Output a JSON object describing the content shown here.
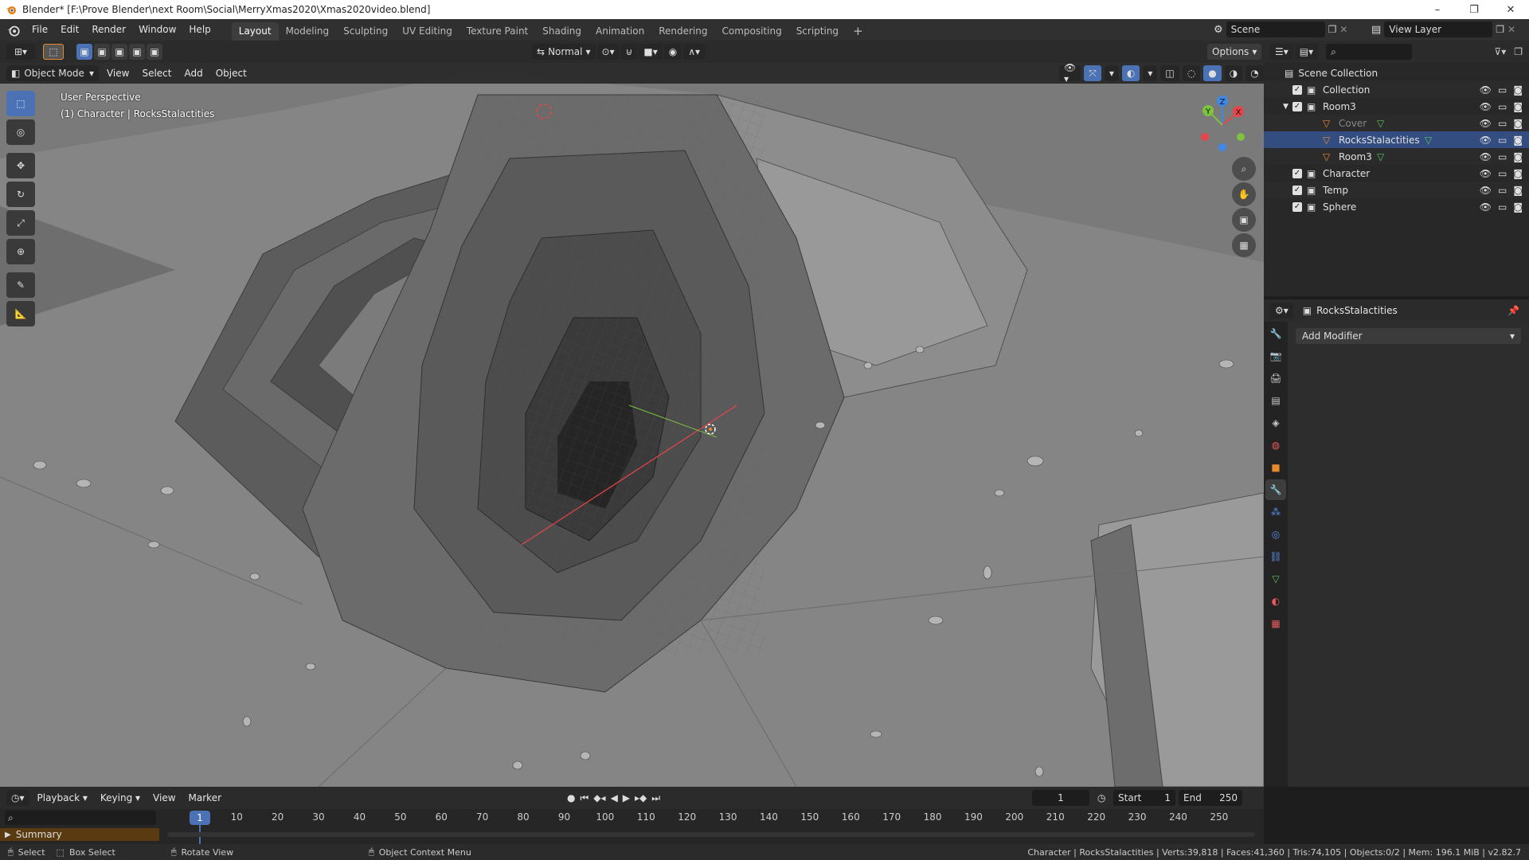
{
  "window": {
    "title": "Blender* [F:\\Prove Blender\\next Room\\Social\\MerryXmas2020\\Xmas2020video.blend]",
    "controls": [
      "–",
      "❐",
      "✕"
    ]
  },
  "menu": [
    "File",
    "Edit",
    "Render",
    "Window",
    "Help"
  ],
  "workspaces": [
    "Layout",
    "Modeling",
    "Sculpting",
    "UV Editing",
    "Texture Paint",
    "Shading",
    "Animation",
    "Rendering",
    "Compositing",
    "Scripting"
  ],
  "active_workspace": "Layout",
  "add_workspace": "+",
  "scene": {
    "label": "Scene",
    "view_layer": "View Layer"
  },
  "viewport_header": {
    "orientation": "Normal",
    "options": "Options"
  },
  "viewport_header2": {
    "mode": "Object Mode",
    "menus": [
      "View",
      "Select",
      "Add",
      "Object"
    ]
  },
  "viewport_overlay": {
    "perspective": "User Perspective",
    "context": "(1) Character | RocksStalactities"
  },
  "gizmo": {
    "x": "X",
    "y": "Y",
    "z": "Z"
  },
  "outliner": {
    "root": "Scene Collection",
    "rows": [
      {
        "label": "Collection",
        "indent": 0,
        "type": "collection"
      },
      {
        "label": "Room3",
        "indent": 0,
        "type": "collection",
        "expanded": true
      },
      {
        "label": "Cover",
        "indent": 1,
        "type": "object",
        "dim": true
      },
      {
        "label": "RocksStalactities",
        "indent": 1,
        "type": "object",
        "selected": true
      },
      {
        "label": "Room3",
        "indent": 1,
        "type": "object"
      },
      {
        "label": "Character",
        "indent": 0,
        "type": "collection"
      },
      {
        "label": "Temp",
        "indent": 0,
        "type": "collection"
      },
      {
        "label": "Sphere",
        "indent": 0,
        "type": "collection"
      }
    ]
  },
  "properties": {
    "object_name": "RocksStalactities",
    "add_modifier": "Add Modifier",
    "tabs": [
      "tool-icon",
      "render-icon",
      "output-icon",
      "view-layer-icon",
      "scene-icon",
      "world-icon",
      "object-icon",
      "modifier-icon",
      "particles-icon",
      "physics-icon",
      "constraints-icon",
      "data-icon",
      "material-icon",
      "texture-icon"
    ],
    "active_tab": "modifier-icon"
  },
  "timeline": {
    "menus": [
      "Playback",
      "Keying",
      "View",
      "Marker"
    ],
    "current_frame": "1",
    "start_label": "Start",
    "start": "1",
    "end_label": "End",
    "end": "250",
    "frame_marks": [
      "10",
      "20",
      "30",
      "40",
      "50",
      "60",
      "70",
      "80",
      "90",
      "100",
      "110",
      "120",
      "130",
      "140",
      "150",
      "160",
      "170",
      "180",
      "190",
      "200",
      "210",
      "220",
      "230",
      "240",
      "250"
    ],
    "summary": "Summary"
  },
  "statusbar": {
    "select": "Select",
    "box_select": "Box Select",
    "rotate_view": "Rotate View",
    "context_menu": "Object Context Menu",
    "stats": "Character | RocksStalactities | Verts:39,818 | Faces:41,360 | Tris:74,105 | Objects:0/2 | Mem: 196.1 MiB | v2.82.7"
  },
  "colors": {
    "accent": "#4a72b5",
    "axis_x": "#e8454a",
    "axis_y": "#7cc43d",
    "axis_z": "#3d88e8",
    "object_orange": "#e8892b",
    "mesh_green": "#59c45b"
  }
}
